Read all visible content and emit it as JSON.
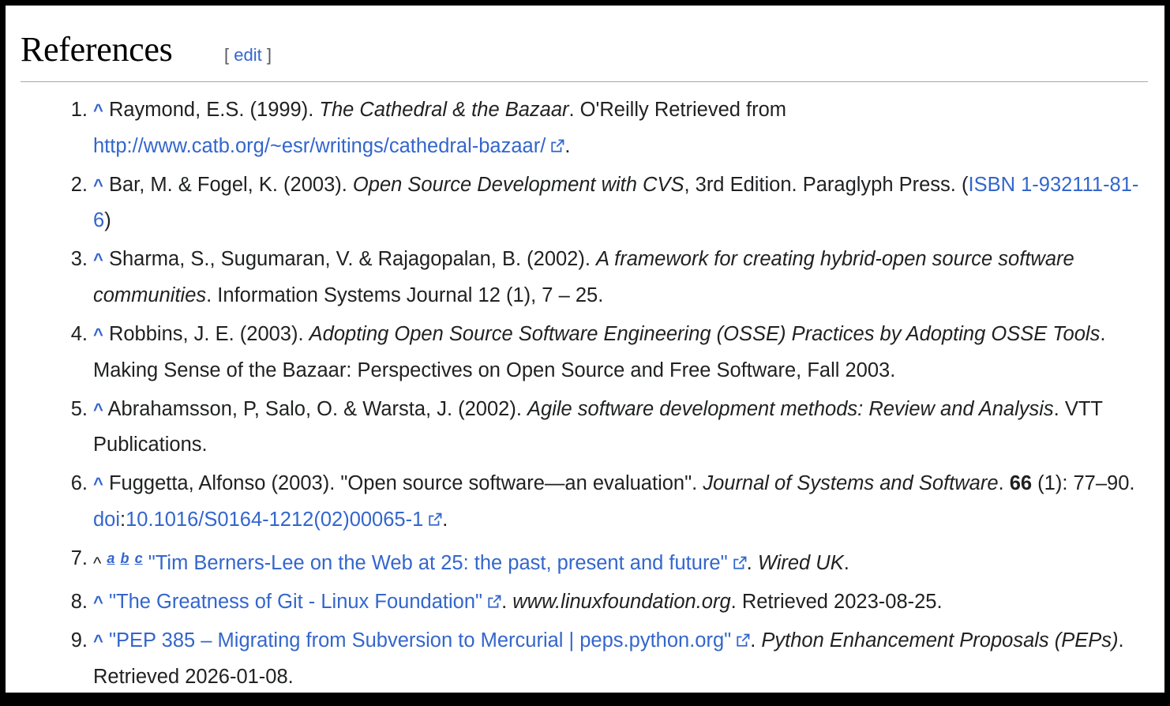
{
  "section": {
    "title": "References",
    "edit_open": "[",
    "edit_label": "edit",
    "edit_close": "]"
  },
  "refs": [
    {
      "num": "1.",
      "caret": "^",
      "pre": " Raymond, E.S. (1999). ",
      "italic": "The Cathedral & the Bazaar",
      "mid": ". O'Reilly Retrieved from ",
      "link": "http://www.catb.org/~esr/writings/cathedral-bazaar/",
      "end": "."
    },
    {
      "num": "2.",
      "caret": "^",
      "pre": " Bar, M. & Fogel, K. (2003). ",
      "italic": "Open Source Development with CVS",
      "mid": ", 3rd Edition. Paraglyph Press. (",
      "link": "ISBN 1-932111-81-6",
      "end": ")"
    },
    {
      "num": "3.",
      "caret": "^",
      "pre": " Sharma, S., Sugumaran, V. & Rajagopalan, B. (2002). ",
      "italic": "A framework for creating hybrid-open source software communities",
      "end": ". Information Systems Journal 12 (1), 7 – 25."
    },
    {
      "num": "4.",
      "caret": "^",
      "pre": " Robbins, J. E. (2003). ",
      "italic": "Adopting Open Source Software Engineering (OSSE) Practices by Adopting OSSE Tools",
      "end": ". Making Sense of the Bazaar: Perspectives on Open Source and Free Software, Fall 2003."
    },
    {
      "num": "5.",
      "caret": "^",
      "pre": " Abrahamsson, P, Salo, O. & Warsta, J. (2002). ",
      "italic": "Agile software development methods: Review and Analysis",
      "end": ". VTT Publications."
    },
    {
      "num": "6.",
      "caret": "^",
      "pre": " Fuggetta, Alfonso (2003). \"Open source software—an evaluation\". ",
      "italic": "Journal of Systems and Software",
      "mid": ". ",
      "bold": "66",
      "mid2": " (1): 77–90. ",
      "link_a": "doi",
      "mid3": ":",
      "link": "10.1016/S0164-1212(02)00065-1",
      "end": "."
    },
    {
      "num": "7.",
      "caret": "^",
      "sup_a": "a",
      "sup_b": "b",
      "sup_c": "c",
      "link": "\"Tim Berners-Lee on the Web at 25: the past, present and future\"",
      "mid": ". ",
      "italic": "Wired UK",
      "end": "."
    },
    {
      "num": "8.",
      "caret": "^",
      "link": "\"The Greatness of Git - Linux Foundation\"",
      "mid": ". ",
      "italic": "www.linuxfoundation.org",
      "end": ". Retrieved 2023-08-25."
    },
    {
      "num": "9.",
      "caret": "^",
      "link": "\"PEP 385 – Migrating from Subversion to Mercurial | peps.python.org\"",
      "mid": ". ",
      "italic": "Python Enhancement Proposals (PEPs)",
      "end": ". Retrieved 2026-01-08."
    }
  ],
  "icons": {
    "external": "external-link-icon"
  },
  "colors": {
    "link": "#3366cc",
    "text": "#202122",
    "rule": "#a2a9b1"
  }
}
